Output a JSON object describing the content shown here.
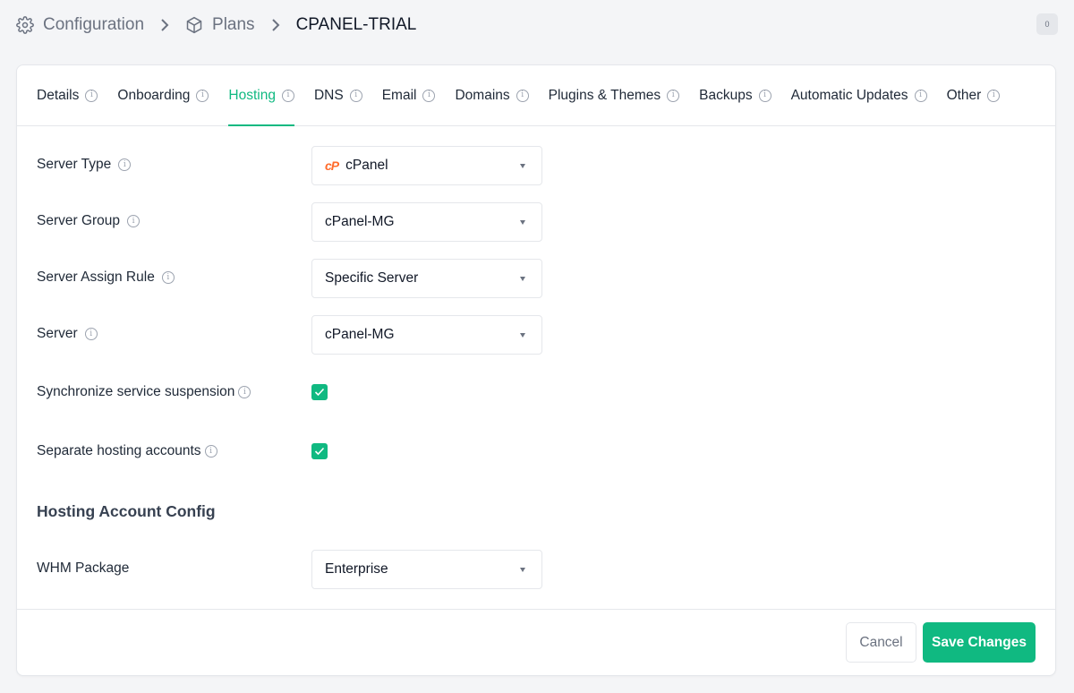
{
  "breadcrumb": {
    "items": [
      {
        "label": "Configuration",
        "icon": "gear-icon"
      },
      {
        "label": "Plans",
        "icon": "cube-icon"
      },
      {
        "label": "CPANEL-TRIAL"
      }
    ]
  },
  "notifications": {
    "count": "0"
  },
  "tabs": [
    {
      "label": "Details"
    },
    {
      "label": "Onboarding"
    },
    {
      "label": "Hosting",
      "active": true
    },
    {
      "label": "DNS"
    },
    {
      "label": "Email"
    },
    {
      "label": "Domains"
    },
    {
      "label": "Plugins & Themes"
    },
    {
      "label": "Backups"
    },
    {
      "label": "Automatic Updates"
    },
    {
      "label": "Other"
    }
  ],
  "form": {
    "server_type": {
      "label": "Server Type",
      "value": "cPanel",
      "logo": "cP"
    },
    "server_group": {
      "label": "Server Group",
      "value": "cPanel-MG"
    },
    "server_assign_rule": {
      "label": "Server Assign Rule",
      "value": "Specific Server"
    },
    "server": {
      "label": "Server",
      "value": "cPanel-MG"
    },
    "sync_suspension": {
      "label": "Synchronize service suspension",
      "checked": true
    },
    "separate_accounts": {
      "label": "Separate hosting accounts",
      "checked": true
    },
    "section_title": "Hosting Account Config",
    "whm_package": {
      "label": "WHM Package",
      "value": "Enterprise"
    }
  },
  "footer": {
    "cancel_label": "Cancel",
    "save_label": "Save Changes"
  },
  "colors": {
    "accent": "#10b981",
    "cpanel": "#ff6c2c"
  }
}
